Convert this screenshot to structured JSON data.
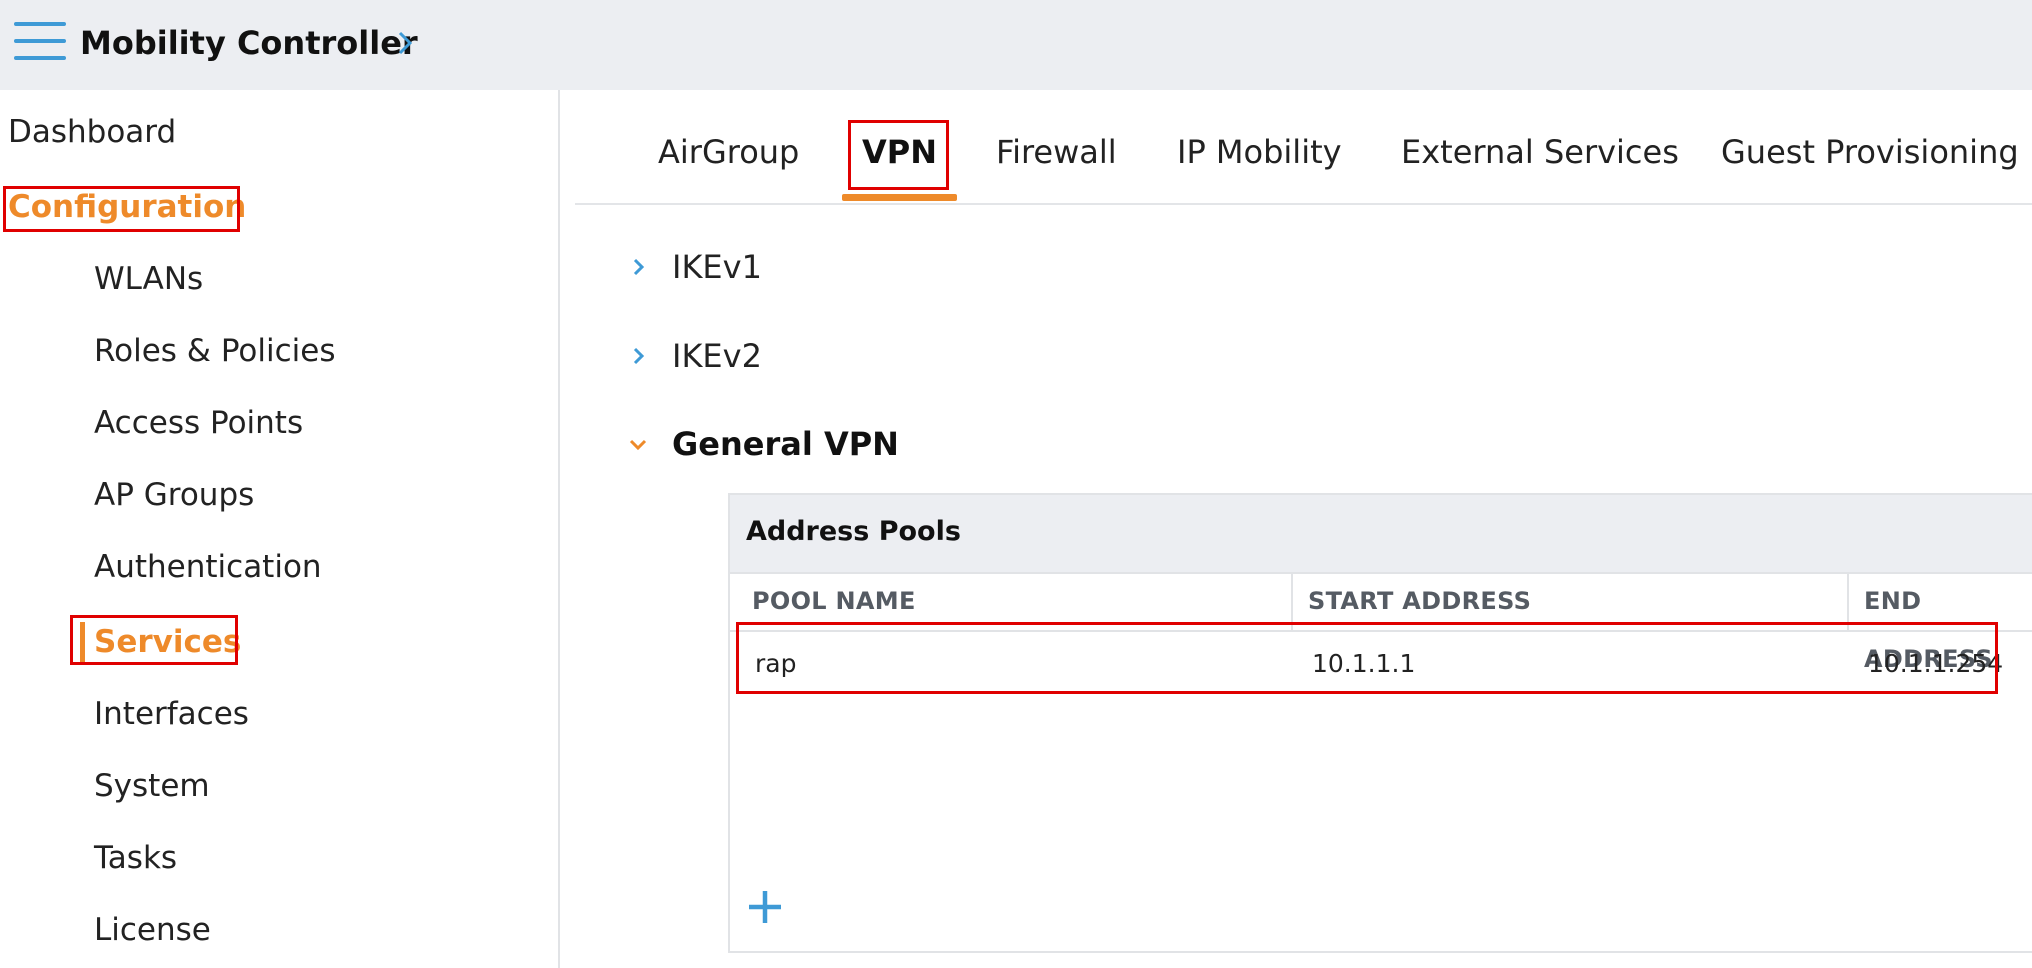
{
  "header": {
    "app_title": "Mobility Controller",
    "menu_icon": "hamburger-menu-icon",
    "breadcrumb_icon": "chevron-right-icon"
  },
  "sidebar": {
    "dashboard": "Dashboard",
    "configuration": "Configuration",
    "items": [
      {
        "label": "WLANs"
      },
      {
        "label": "Roles & Policies"
      },
      {
        "label": "Access Points"
      },
      {
        "label": "AP Groups"
      },
      {
        "label": "Authentication"
      },
      {
        "label": "Services"
      },
      {
        "label": "Interfaces"
      },
      {
        "label": "System"
      },
      {
        "label": "Tasks"
      },
      {
        "label": "License"
      }
    ],
    "active_item": "Services"
  },
  "tabs": {
    "items": [
      {
        "label": "AirGroup"
      },
      {
        "label": "VPN"
      },
      {
        "label": "Firewall"
      },
      {
        "label": "IP Mobility"
      },
      {
        "label": "External Services"
      },
      {
        "label": "Guest Provisioning"
      }
    ],
    "active": "VPN"
  },
  "sections": [
    {
      "label": "IKEv1",
      "expanded": false
    },
    {
      "label": "IKEv2",
      "expanded": false
    },
    {
      "label": "General VPN",
      "expanded": true
    }
  ],
  "address_pools": {
    "title": "Address Pools",
    "columns": [
      "POOL NAME",
      "START ADDRESS",
      "END ADDRESS"
    ],
    "rows": [
      {
        "pool_name": "rap",
        "start_address": "10.1.1.1",
        "end_address": "10.1.1.254"
      }
    ],
    "add_icon": "plus-icon"
  },
  "colors": {
    "accent": "#ee8a2a",
    "link_blue": "#3e9ad6",
    "highlight_red": "#e00000",
    "header_bg": "#eceef2"
  }
}
